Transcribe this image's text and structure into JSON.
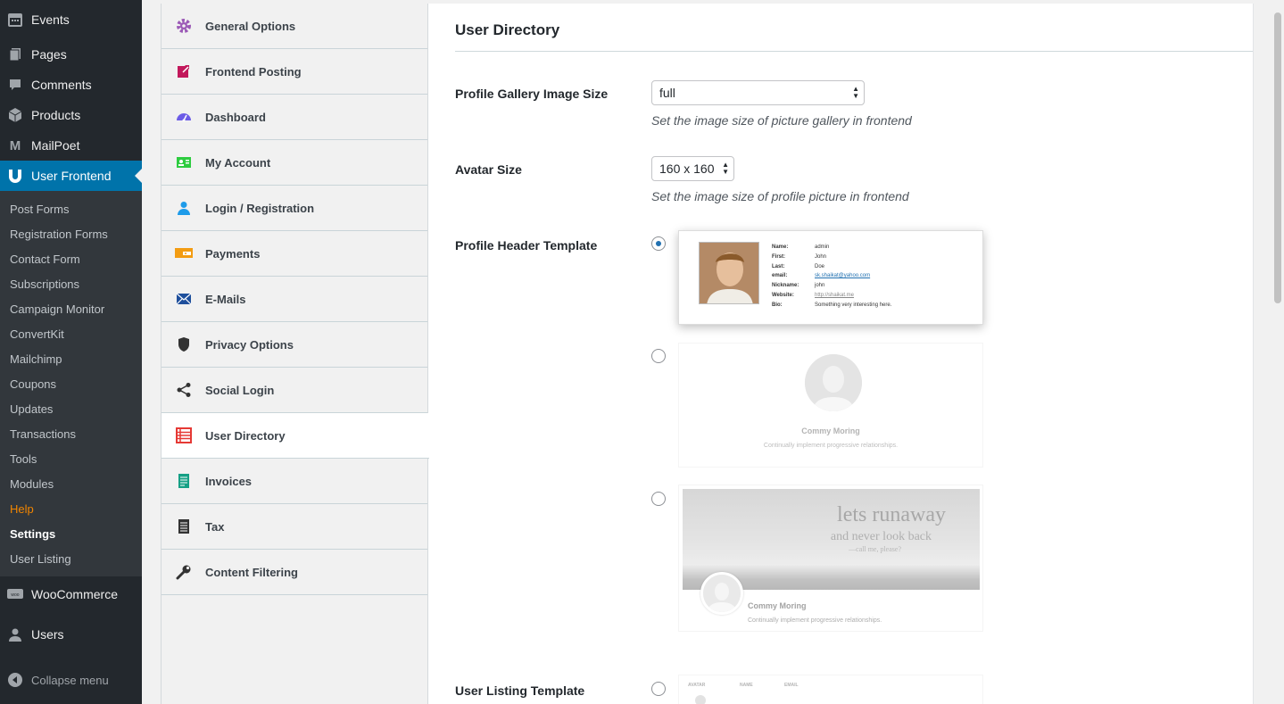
{
  "sidebar": {
    "top_items": [
      {
        "label": "Events",
        "icon": "calendar-icon"
      },
      {
        "label": "Pages",
        "icon": "pages-icon"
      },
      {
        "label": "Comments",
        "icon": "comment-icon"
      },
      {
        "label": "Products",
        "icon": "box-icon"
      },
      {
        "label": "MailPoet",
        "icon": "mailpoet-icon"
      }
    ],
    "current": {
      "label": "User Frontend",
      "icon": "user-frontend-icon"
    },
    "submenu": [
      "Post Forms",
      "Registration Forms",
      "Contact Form",
      "Subscriptions",
      "Campaign Monitor",
      "ConvertKit",
      "Mailchimp",
      "Coupons",
      "Updates",
      "Transactions",
      "Tools",
      "Modules",
      "Help",
      "Settings",
      "User Listing"
    ],
    "bottom_items": [
      {
        "label": "WooCommerce",
        "icon": "woo-icon"
      },
      {
        "label": "Users",
        "icon": "users-icon"
      }
    ],
    "collapse_label": "Collapse menu"
  },
  "tabs": [
    {
      "label": "General Options",
      "icon": "gear-icon",
      "color": "#9b59b6"
    },
    {
      "label": "Frontend Posting",
      "icon": "edit-icon",
      "color": "#c2185b"
    },
    {
      "label": "Dashboard",
      "icon": "dashboard-icon",
      "color": "#6c5ce7"
    },
    {
      "label": "My Account",
      "icon": "id-card-icon",
      "color": "#2ecc40"
    },
    {
      "label": "Login / Registration",
      "icon": "user-icon",
      "color": "#1e9be9"
    },
    {
      "label": "Payments",
      "icon": "payment-icon",
      "color": "#f39c12"
    },
    {
      "label": "E-Mails",
      "icon": "envelope-icon",
      "color": "#1e4f9c"
    },
    {
      "label": "Privacy Options",
      "icon": "shield-icon",
      "color": "#333333"
    },
    {
      "label": "Social Login",
      "icon": "share-icon",
      "color": "#333333"
    },
    {
      "label": "User Directory",
      "icon": "list-icon",
      "color": "#e53935"
    },
    {
      "label": "Invoices",
      "icon": "invoice-icon",
      "color": "#16a085"
    },
    {
      "label": "Tax",
      "icon": "document-icon",
      "color": "#333333"
    },
    {
      "label": "Content Filtering",
      "icon": "wrench-icon",
      "color": "#333333"
    }
  ],
  "active_tab": "User Directory",
  "panel": {
    "title": "User Directory",
    "gallery": {
      "label": "Profile Gallery Image Size",
      "value": "full",
      "desc": "Set the image size of picture gallery in frontend"
    },
    "avatar": {
      "label": "Avatar Size",
      "value": "160 x 160",
      "desc": "Set the image size of profile picture in frontend"
    },
    "header_template": {
      "label": "Profile Header Template",
      "selected_index": 0
    },
    "listing_template": {
      "label": "User Listing Template"
    }
  },
  "template1": {
    "rows": [
      {
        "k": "Name:",
        "v": "admin"
      },
      {
        "k": "First:",
        "v": "John"
      },
      {
        "k": "Last:",
        "v": "Doe"
      },
      {
        "k": "email:",
        "v": "sk.shaikat@yahoo.com"
      },
      {
        "k": "Nickname:",
        "v": "john"
      },
      {
        "k": "Website:",
        "v": "http://shaikat.me"
      },
      {
        "k": "Bio:",
        "v": "Something very interesting here."
      }
    ]
  },
  "template2": {
    "name": "Commy Moring",
    "bio": "Continually implement progressive relationships."
  },
  "template3": {
    "line1": "lets runaway",
    "line2": "and never look back",
    "line3": "—call me, please?",
    "name": "Commy Moring",
    "bio": "Continually implement progressive relationships."
  },
  "template4": {
    "headers": [
      "AVATAR",
      "NAME",
      "EMAIL"
    ]
  }
}
